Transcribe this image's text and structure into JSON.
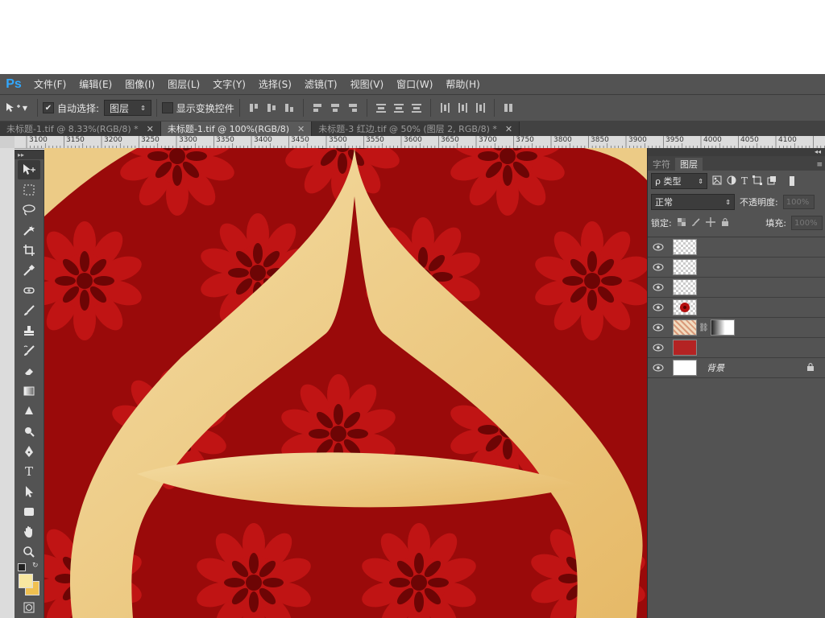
{
  "app": {
    "logo": "Ps"
  },
  "menu": [
    "文件(F)",
    "编辑(E)",
    "图像(I)",
    "图层(L)",
    "文字(Y)",
    "选择(S)",
    "滤镜(T)",
    "视图(V)",
    "窗口(W)",
    "帮助(H)"
  ],
  "options": {
    "auto_select_label": "自动选择:",
    "auto_select_checked": true,
    "auto_select_target": "图层",
    "show_transform_label": "显示变换控件",
    "show_transform_checked": false
  },
  "tabs": [
    {
      "label": "未标题-1.tif @ 8.33%(RGB/8) *",
      "active": false
    },
    {
      "label": "未标题-1.tif @ 100%(RGB/8)",
      "active": true
    },
    {
      "label": "未标题-3  红边.tif @ 50% (图层 2, RGB/8) *",
      "active": false
    }
  ],
  "ruler": [
    "3100",
    "3150",
    "3200",
    "3250",
    "3300",
    "3350",
    "3400",
    "3450",
    "3500",
    "3550",
    "3600",
    "3650",
    "3700",
    "3750",
    "3800",
    "3850",
    "3900",
    "3950",
    "4000",
    "4050",
    "4100"
  ],
  "panel": {
    "tabs": [
      "字符",
      "图层"
    ],
    "active_tab": "图层",
    "filter_label": "ρ 类型",
    "blend_mode": "正常",
    "opacity_label": "不透明度:",
    "opacity_value": "100%",
    "lock_label": "锁定:",
    "fill_label": "填充:",
    "fill_value": "100%",
    "layers": [
      {
        "name": "",
        "thumb": "transparent"
      },
      {
        "name": "",
        "thumb": "transparent"
      },
      {
        "name": "",
        "thumb": "transparent"
      },
      {
        "name": "",
        "thumb": "red-flower"
      },
      {
        "name": "",
        "thumb": "pattern-with-mask"
      },
      {
        "name": "",
        "thumb": "red-fill"
      },
      {
        "name": "背景",
        "thumb": "white",
        "locked": true
      }
    ]
  },
  "colors": {
    "ui_dark": "#535353",
    "canvas_red": "#9a0a0a",
    "gold": "#eccb86",
    "foreground": "#f8e7a0",
    "background": "#f0c050"
  }
}
